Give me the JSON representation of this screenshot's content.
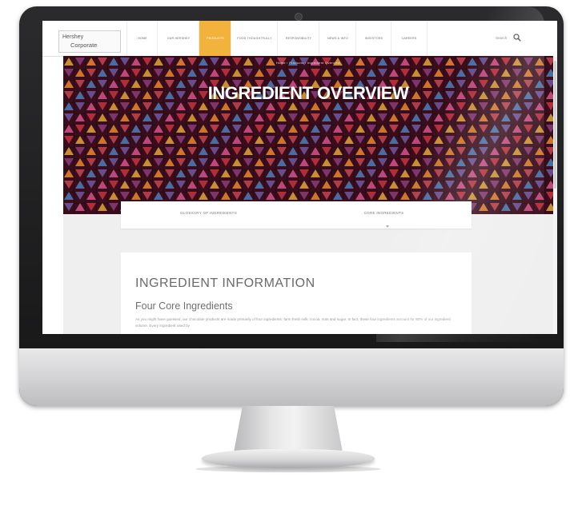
{
  "header": {
    "logo": {
      "line1": "Hershey",
      "line2": "Corporate"
    },
    "nav": [
      {
        "label": "HOME"
      },
      {
        "label": "OUR HERSHEY"
      },
      {
        "label": "PRODUCTS",
        "active": true
      },
      {
        "label": "FOOD THOUGHTFULLY"
      },
      {
        "label": "RESPONSIBILITY"
      },
      {
        "label": "NEWS & INFO"
      },
      {
        "label": "INVESTORS"
      },
      {
        "label": "CAREERS"
      }
    ],
    "search_label": "Search"
  },
  "breadcrumb": "Home  ›  Products  ›  Ingredient Overview",
  "hero": {
    "title": "INGREDIENT OVERVIEW",
    "pattern_colors": [
      "#e0a63b",
      "#c8343f",
      "#d2568a",
      "#6e5aa0",
      "#4c7fb8",
      "#c4464f",
      "#e58a2e",
      "#8a3d7a"
    ]
  },
  "tabs": [
    {
      "label": "GLOSSARY OF INGREDIENTS"
    },
    {
      "label": "CORE INGREDIENTS"
    }
  ],
  "card": {
    "title": "INGREDIENT INFORMATION",
    "subtitle": "Four Core Ingredients",
    "body": "As you might have guessed, our chocolate products are made primarily of four ingredients: farm fresh milk, cocoa, nuts and sugar. In fact, these four ingredients account for 80% of our ingredient volume. Every ingredient used by"
  },
  "colors": {
    "nav_active": "#f2b33c",
    "hero_background": "#3a0d1c"
  }
}
